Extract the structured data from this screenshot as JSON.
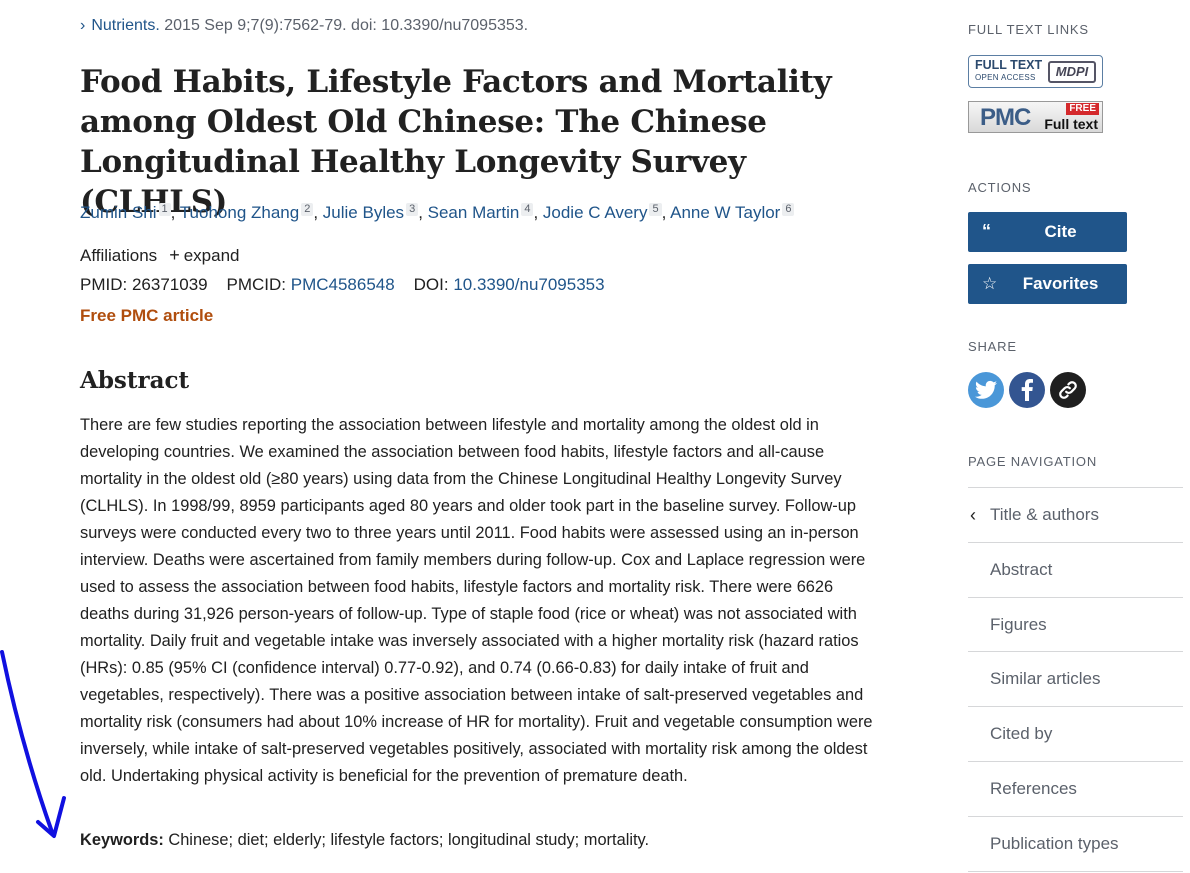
{
  "citation": {
    "journal": "Nutrients.",
    "details": " 2015 Sep 9;7(9):7562-79. doi: 10.3390/nu7095353."
  },
  "title": "Food Habits, Lifestyle Factors and Mortality among Oldest Old Chinese: The Chinese Longitudinal Healthy Longevity Survey (CLHLS)",
  "authors": [
    {
      "name": "Zumin Shi",
      "aff": "1"
    },
    {
      "name": "Tuohong Zhang",
      "aff": "2"
    },
    {
      "name": "Julie Byles",
      "aff": "3"
    },
    {
      "name": "Sean Martin",
      "aff": "4"
    },
    {
      "name": "Jodie C Avery",
      "aff": "5"
    },
    {
      "name": "Anne W Taylor",
      "aff": "6"
    }
  ],
  "affiliations": {
    "label": "Affiliations",
    "expand": "expand"
  },
  "ids": {
    "pmid_label": "PMID:",
    "pmid": "26371039",
    "pmcid_label": "PMCID:",
    "pmcid": "PMC4586548",
    "doi_label": "DOI:",
    "doi": "10.3390/nu7095353"
  },
  "free_pmc": "Free PMC article",
  "abstract": {
    "heading": "Abstract",
    "text": "There are few studies reporting the association between lifestyle and mortality among the oldest old in developing countries. We examined the association between food habits, lifestyle factors and all-cause mortality in the oldest old (≥80 years) using data from the Chinese Longitudinal Healthy Longevity Survey (CLHLS). In 1998/99, 8959 participants aged 80 years and older took part in the baseline survey. Follow-up surveys were conducted every two to three years until 2011. Food habits were assessed using an in-person interview. Deaths were ascertained from family members during follow-up. Cox and Laplace regression were used to assess the association between food habits, lifestyle factors and mortality risk. There were 6626 deaths during 31,926 person-years of follow-up. Type of staple food (rice or wheat) was not associated with mortality. Daily fruit and vegetable intake was inversely associated with a higher mortality risk (hazard ratios (HRs): 0.85 (95% CI (confidence interval) 0.77-0.92), and 0.74 (0.66-0.83) for daily intake of fruit and vegetables, respectively). There was a positive association between intake of salt-preserved vegetables and mortality risk (consumers had about 10% increase of HR for mortality). Fruit and vegetable consumption were inversely, while intake of salt-preserved vegetables positively, associated with mortality risk among the oldest old. Undertaking physical activity is beneficial for the prevention of premature death.",
    "keywords_label": "Keywords:",
    "keywords": " Chinese; diet; elderly; lifestyle factors; longitudinal study; mortality."
  },
  "sidebar": {
    "full_text_links": "FULL TEXT LINKS",
    "mdpi_badge": {
      "full_text": "FULL TEXT",
      "open_access": "OPEN ACCESS",
      "brand": "MDPI"
    },
    "pmc_badge": {
      "brand": "PMC",
      "free": "FREE",
      "full_text": "Full text"
    },
    "actions": "ACTIONS",
    "cite": "Cite",
    "favorites": "Favorites",
    "share": "SHARE",
    "page_navigation": "PAGE NAVIGATION",
    "nav_items": [
      "Title & authors",
      "Abstract",
      "Figures",
      "Similar articles",
      "Cited by",
      "References",
      "Publication types"
    ]
  },
  "colors": {
    "link": "#20558a",
    "free_pmc": "#b04e0e",
    "button": "#20558a",
    "annotation": "#1010e0"
  }
}
